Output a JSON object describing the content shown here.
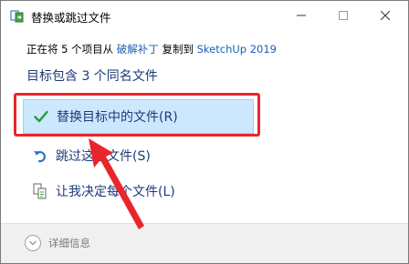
{
  "window": {
    "title": "替换或跳过文件"
  },
  "info": {
    "prefix": "正在将 5 个项目从 ",
    "source": "破解补丁",
    "middle": " 复制到 ",
    "destination": "SketchUp 2019"
  },
  "heading": "目标包含 3 个同名文件",
  "options": [
    {
      "label": "替换目标中的文件(R)",
      "icon": "check-icon"
    },
    {
      "label": "跳过这些文件(S)",
      "icon": "skip-arrow-icon"
    },
    {
      "label": "让我决定每个文件(L)",
      "icon": "compare-files-icon"
    }
  ],
  "footer": {
    "details_label": "详细信息"
  },
  "colors": {
    "highlight_bg": "#cce8ff",
    "annotation_red": "#e8262b",
    "link_blue": "#1a5fb4",
    "check_green": "#2b9a3c"
  }
}
